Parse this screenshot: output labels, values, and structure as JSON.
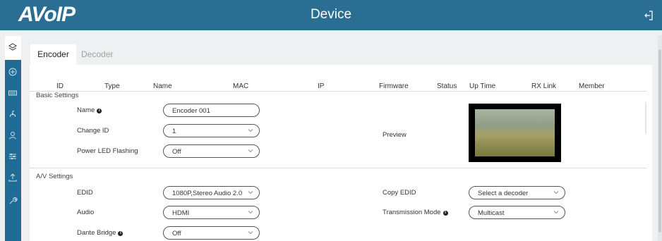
{
  "header": {
    "logo": "AVoIP",
    "title": "Device"
  },
  "sidebar": {
    "icons": [
      "layers-icon",
      "plus-circle-icon",
      "keyboard-icon",
      "fan-icon",
      "user-icon",
      "sliders-icon",
      "upload-icon",
      "wrench-icon"
    ]
  },
  "tabs": [
    {
      "label": "Encoder",
      "active": true
    },
    {
      "label": "Decoder",
      "active": false
    }
  ],
  "columns": [
    "ID",
    "Type",
    "Name",
    "MAC",
    "IP",
    "Firmware",
    "Status",
    "Up Time",
    "RX Link",
    "Member"
  ],
  "basic": {
    "section": "Basic Settings",
    "name_label": "Name",
    "name_value": "Encoder 001",
    "change_id_label": "Change ID",
    "change_id_value": "1",
    "power_led_label": "Power LED Flashing",
    "power_led_value": "Off",
    "preview_label": "Preview"
  },
  "av": {
    "section": "A/V Settings",
    "edid_label": "EDID",
    "edid_value": "1080P,Stereo Audio 2.0",
    "audio_label": "Audio",
    "audio_value": "HDMI",
    "dante_label": "Dante Bridge",
    "dante_value": "Off",
    "copy_edid_label": "Copy EDID",
    "copy_edid_value": "Select a decoder",
    "transmission_label": "Transmission Mode",
    "transmission_value": "Multicast"
  },
  "colors": {
    "header": "#2a6f93",
    "sidebar": "#1e6b93"
  }
}
